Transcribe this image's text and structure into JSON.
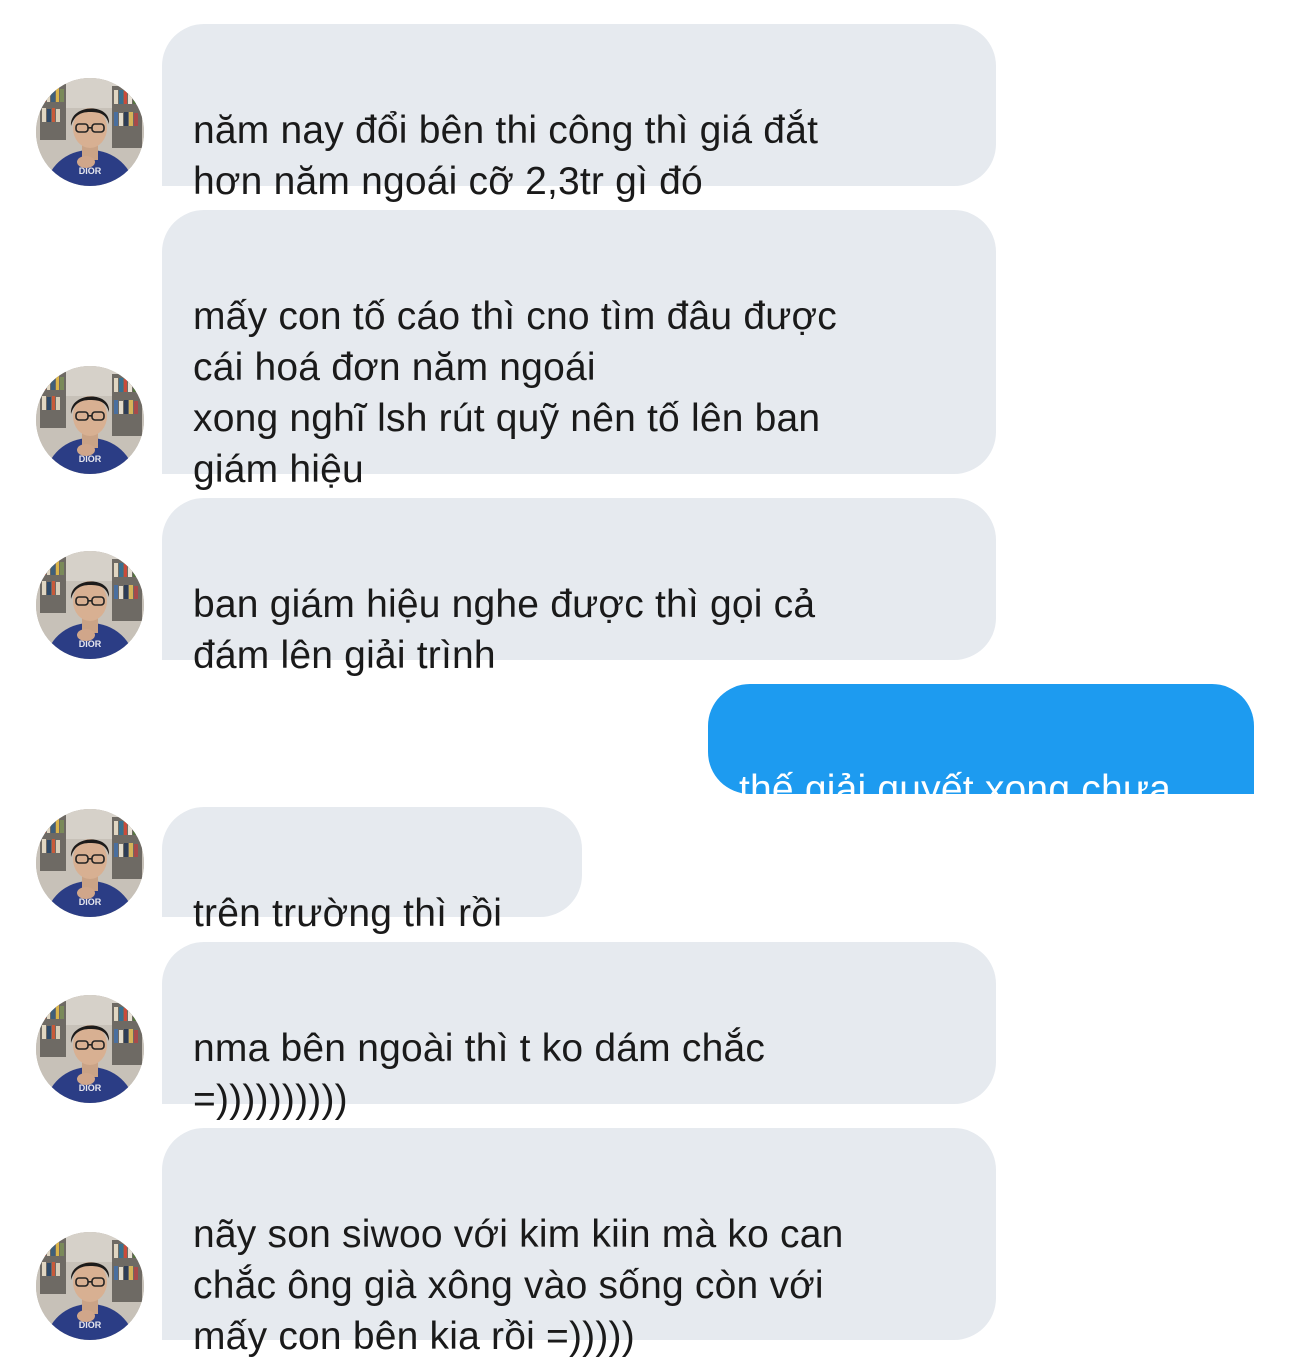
{
  "conversation": {
    "messages": [
      {
        "sender": "them",
        "text": "năm nay đổi bên thi công thì giá đắt\nhơn năm ngoái cỡ 2,3tr gì đó"
      },
      {
        "sender": "them",
        "text": "mấy con tố cáo thì cno tìm đâu được\ncái hoá đơn năm ngoái\nxong nghĩ lsh rút quỹ nên tố lên ban\ngiám hiệu"
      },
      {
        "sender": "them",
        "text": "ban giám hiệu nghe được thì gọi cả\nđám lên giải trình"
      },
      {
        "sender": "me",
        "text": "thế giải quyết xong chưa"
      },
      {
        "sender": "them",
        "text": "trên trường thì rồi"
      },
      {
        "sender": "them",
        "text": "nma bên ngoài thì t ko dám chắc\n=))))))))))"
      },
      {
        "sender": "them",
        "text": "nãy son siwoo với kim kiin mà ko can\nchắc ông già xông vào sống còn với\nmấy con bên kia rồi =)))))"
      }
    ]
  },
  "colors": {
    "incoming_bubble": "#e6eaef",
    "incoming_text": "#1a1a1a",
    "outgoing_bubble": "#1d9bf0",
    "outgoing_text": "#ffffff"
  },
  "icons": {
    "avatar": "contact-avatar-photo"
  }
}
